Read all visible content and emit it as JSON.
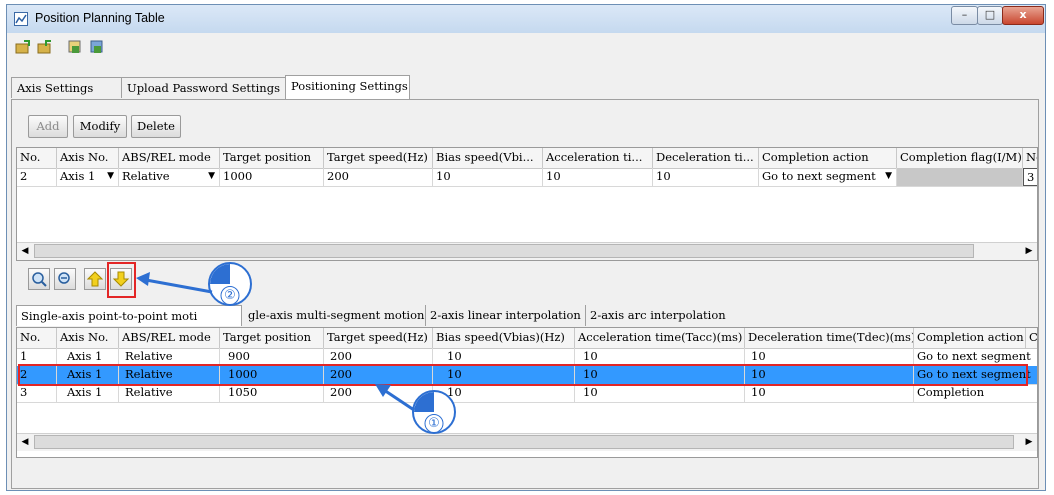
{
  "window": {
    "title": "Position Planning Table",
    "buttons": [
      "–",
      "□",
      "x"
    ]
  },
  "toolbar": {
    "icons": [
      "open-icon",
      "save-icon",
      "import-icon",
      "export-icon"
    ]
  },
  "tabs": [
    "Axis Settings",
    "Upload Password Settings",
    "Positioning Settings"
  ],
  "actions": {
    "add": "Add",
    "modify": "Modify",
    "delete": "Delete"
  },
  "top_table": {
    "headers": [
      "No.",
      "Axis No.",
      "ABS/REL mode",
      "Target position",
      "Target speed(Hz)",
      "Bias speed(Vbi...",
      "Acceleration ti...",
      "Deceleration ti...",
      "Completion action",
      "Completion flag(I/M)",
      "Nc"
    ],
    "row": {
      "no": "2",
      "axis": "Axis 1",
      "mode": "Relative",
      "target_position": "1000",
      "target_speed": "200",
      "bias_speed": "10",
      "acceleration": "10",
      "deceleration": "10",
      "completion_action": "Go to next segment",
      "completion_flag": "",
      "nc": "3"
    }
  },
  "sub_tabs": [
    "Single-axis point-to-point moti",
    "gle-axis multi-segment motion",
    "2-axis linear interpolation",
    "2-axis arc interpolation"
  ],
  "bottom_table": {
    "headers": [
      "No.",
      "Axis No.",
      "ABS/REL mode",
      "Target position",
      "Target speed(Hz)",
      "Bias speed(Vbias)(Hz)",
      "Acceleration time(Tacc)(ms)",
      "Deceleration time(Tdec)(ms)",
      "Completion action",
      "Co"
    ],
    "rows": [
      [
        "1",
        "Axis 1",
        "Relative",
        "900",
        "200",
        "10",
        "10",
        "10",
        "Go to next segment"
      ],
      [
        "2",
        "Axis 1",
        "Relative",
        "1000",
        "200",
        "10",
        "10",
        "10",
        "Go to next segment"
      ],
      [
        "3",
        "Axis 1",
        "Relative",
        "1050",
        "200",
        "10",
        "10",
        "10",
        "Completion"
      ]
    ],
    "selected_row": "2"
  },
  "callouts": {
    "one": "①",
    "two": "②"
  },
  "colors": {
    "selection": "#3399ff",
    "highlight": "#e32626",
    "callout": "#2d6fd2"
  }
}
